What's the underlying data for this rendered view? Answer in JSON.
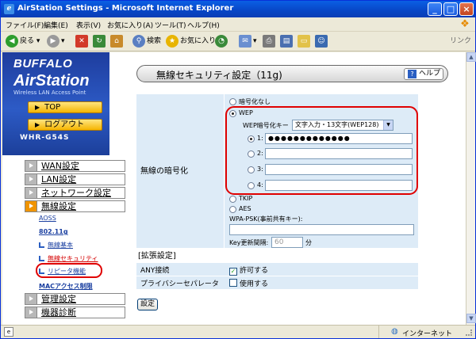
{
  "window": {
    "title": "AirStation Settings - Microsoft Internet Explorer",
    "minimize": "_",
    "maximize": "□",
    "close": "×"
  },
  "menu": [
    "ファイル(F)",
    "編集(E)",
    "表示(V)",
    "お気に入り(A)",
    "ツール(T)",
    "ヘルプ(H)"
  ],
  "toolbar": {
    "back": "戻る",
    "search": "検索",
    "favorites": "お気に入り",
    "links": "リンク"
  },
  "sidebar": {
    "brand_top": "BUFFALO",
    "brand_name": "AirStation",
    "brand_tag": "Wireless LAN Access Point",
    "top_button": "TOP",
    "logout_button": "ログアウト",
    "model": "WHR-G54S",
    "nav": [
      {
        "label": "WAN設定"
      },
      {
        "label": "LAN設定"
      },
      {
        "label": "ネットワーク設定"
      },
      {
        "label": "無線設定"
      },
      {
        "label": "管理設定"
      },
      {
        "label": "機器診断"
      }
    ],
    "sub": {
      "aoss": "AOSS",
      "std": "802.11g",
      "basic": "無線基本",
      "security": "無線セキュリティ",
      "repeater": "リピータ機能",
      "mac": "MACアクセス制限"
    }
  },
  "main": {
    "title": "無線セキュリティ設定（11g)",
    "help": "ヘルプ",
    "encryption_label": "無線の暗号化",
    "opt_none": "暗号化なし",
    "opt_wep": "WEP",
    "wep_key_label": "WEP暗号化キー",
    "wep_key_type": "文字入力・13文字(WEP128)",
    "keys": [
      {
        "label": "1:",
        "value": "●●●●●●●●●●●●●",
        "selected": true
      },
      {
        "label": "2:",
        "value": ""
      },
      {
        "label": "3:",
        "value": ""
      },
      {
        "label": "4:",
        "value": ""
      }
    ],
    "opt_tkip": "TKIP",
    "opt_aes": "AES",
    "psk_label": "WPA-PSK(事前共有キー):",
    "psk_value": "",
    "rekey_label": "Key更新間隔:",
    "rekey_value": "60",
    "rekey_unit": "分",
    "ext_title": "[拡張設定]",
    "any_label": "ANY接続",
    "any_value": "許可する",
    "priv_label": "プライバシーセパレータ",
    "priv_value": "使用する",
    "submit": "設定"
  },
  "status": {
    "zone": "インターネット"
  }
}
